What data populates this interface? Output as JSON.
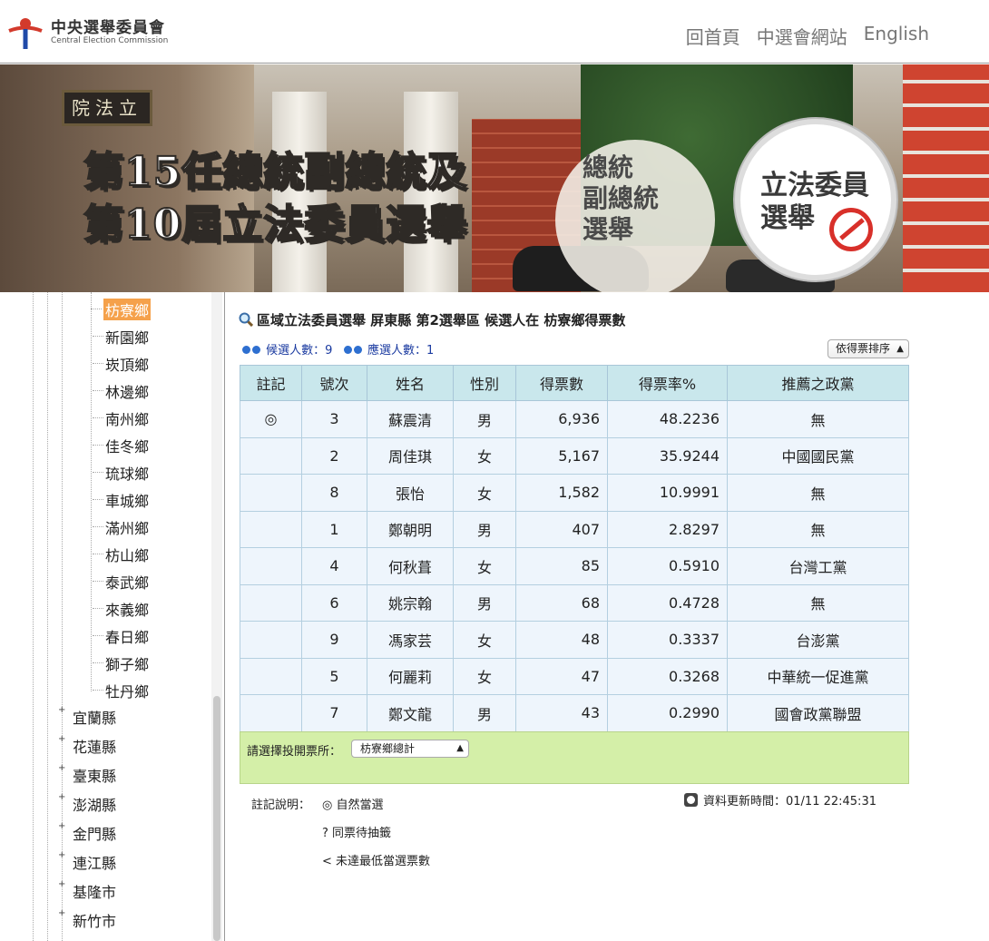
{
  "header": {
    "org_zh": "中央選舉委員會",
    "org_en": "Central Election Commission",
    "nav": [
      "回首頁",
      "中選會網站",
      "English"
    ]
  },
  "banner": {
    "title_line1": "第15任總統副總統及",
    "title_line2": "第10屆立法委員選舉",
    "building_sign": "院法立",
    "btn_president": [
      "總統",
      "副總統",
      "選舉"
    ],
    "btn_legislator": [
      "立法委員",
      "選舉"
    ]
  },
  "sidebar": {
    "townships": [
      "枋寮鄉",
      "新園鄉",
      "崁頂鄉",
      "林邊鄉",
      "南州鄉",
      "佳冬鄉",
      "琉球鄉",
      "車城鄉",
      "滿州鄉",
      "枋山鄉",
      "泰武鄉",
      "來義鄉",
      "春日鄉",
      "獅子鄉",
      "牡丹鄉"
    ],
    "selected": "枋寮鄉",
    "counties": [
      "宜蘭縣",
      "花蓮縣",
      "臺東縣",
      "澎湖縣",
      "金門縣",
      "連江縣",
      "基隆市",
      "新竹市"
    ]
  },
  "main": {
    "title": "區域立法委員選舉 屏東縣 第2選舉區 候選人在 枋寮鄉得票數",
    "candidates_label": "候選人數：9",
    "seats_label": "應選人數：1",
    "sort_option": "依得票排序",
    "columns": [
      "註記",
      "號次",
      "姓名",
      "性別",
      "得票數",
      "得票率%",
      "推薦之政黨"
    ],
    "rows": [
      [
        "◎",
        "3",
        "蘇震清",
        "男",
        "6,936",
        "48.2236",
        "無"
      ],
      [
        "",
        "2",
        "周佳琪",
        "女",
        "5,167",
        "35.9244",
        "中國國民黨"
      ],
      [
        "",
        "8",
        "張怡",
        "女",
        "1,582",
        "10.9991",
        "無"
      ],
      [
        "",
        "1",
        "鄭朝明",
        "男",
        "407",
        "2.8297",
        "無"
      ],
      [
        "",
        "4",
        "何秋葺",
        "女",
        "85",
        "0.5910",
        "台灣工黨"
      ],
      [
        "",
        "6",
        "姚宗翰",
        "男",
        "68",
        "0.4728",
        "無"
      ],
      [
        "",
        "9",
        "馮家芸",
        "女",
        "48",
        "0.3337",
        "台澎黨"
      ],
      [
        "",
        "5",
        "何麗莉",
        "女",
        "47",
        "0.3268",
        "中華統一促進黨"
      ],
      [
        "",
        "7",
        "鄭文龍",
        "男",
        "43",
        "0.2990",
        "國會政黨聯盟"
      ]
    ],
    "station_label": "請選擇投開票所：",
    "station_value": "枋寮鄉總計",
    "legend_title": "註記說明：",
    "legend_items": [
      "◎ 自然當選",
      "? 同票待抽籤",
      "< 未達最低當選票數"
    ],
    "update_text": "資料更新時間：01/11 22:45:31"
  },
  "colors": {
    "table_header": "#c9e7ec",
    "table_cell": "#eef5fc",
    "selection_bg": "#f5a14b",
    "station_panel": "#d4efa8"
  }
}
